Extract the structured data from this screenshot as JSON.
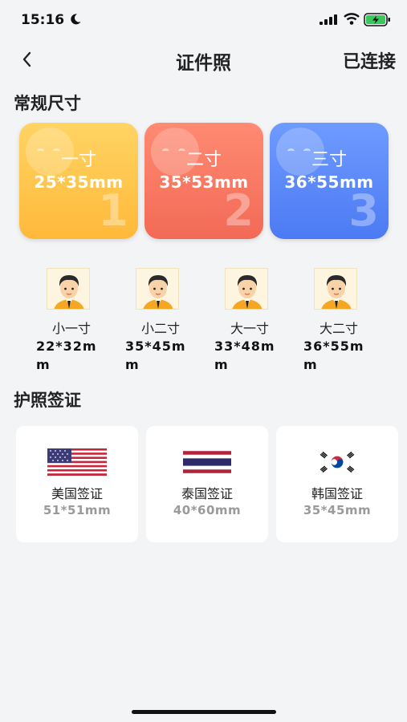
{
  "status": {
    "time": "15:16"
  },
  "nav": {
    "title": "证件照",
    "right_label": "已连接"
  },
  "sections": {
    "regular": "常规尺寸",
    "visa": "护照签证"
  },
  "big_cards": [
    {
      "name": "一寸",
      "dim": "25*35mm",
      "num": "1",
      "color_top": "#ffd463",
      "color_bottom": "#ffb93a"
    },
    {
      "name": "二寸",
      "dim": "35*53mm",
      "num": "2",
      "color_top": "#ff8a72",
      "color_bottom": "#f26a56"
    },
    {
      "name": "三寸",
      "dim": "36*55mm",
      "num": "3",
      "color_top": "#6e9bff",
      "color_bottom": "#4c7af3"
    }
  ],
  "small_items": [
    {
      "name": "小一寸",
      "dim": "22*32mm"
    },
    {
      "name": "小二寸",
      "dim": "35*45mm"
    },
    {
      "name": "大一寸",
      "dim": "33*48mm"
    },
    {
      "name": "大二寸",
      "dim": "36*55mm"
    }
  ],
  "visas": [
    {
      "name": "美国签证",
      "dim": "51*51mm",
      "flag": "us-flag-icon"
    },
    {
      "name": "泰国签证",
      "dim": "40*60mm",
      "flag": "thailand-flag-icon"
    },
    {
      "name": "韩国签证",
      "dim": "35*45mm",
      "flag": "korea-flag-icon"
    }
  ]
}
